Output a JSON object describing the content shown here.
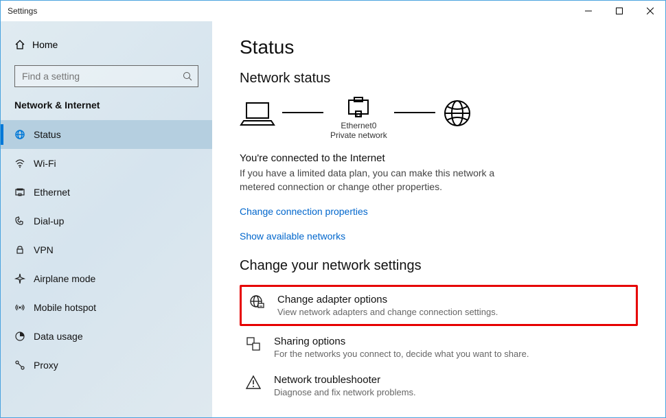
{
  "window_title": "Settings",
  "sidebar": {
    "home": "Home",
    "search_placeholder": "Find a setting",
    "category": "Network & Internet",
    "items": [
      {
        "label": "Status"
      },
      {
        "label": "Wi-Fi"
      },
      {
        "label": "Ethernet"
      },
      {
        "label": "Dial-up"
      },
      {
        "label": "VPN"
      },
      {
        "label": "Airplane mode"
      },
      {
        "label": "Mobile hotspot"
      },
      {
        "label": "Data usage"
      },
      {
        "label": "Proxy"
      }
    ]
  },
  "main": {
    "title": "Status",
    "subtitle": "Network status",
    "diagram": {
      "mid_caption1": "Ethernet0",
      "mid_caption2": "Private network"
    },
    "connected_head": "You're connected to the Internet",
    "connected_desc": "If you have a limited data plan, you can make this network a metered connection or change other properties.",
    "link1": "Change connection properties",
    "link2": "Show available networks",
    "change_section": "Change your network settings",
    "options": [
      {
        "title": "Change adapter options",
        "desc": "View network adapters and change connection settings."
      },
      {
        "title": "Sharing options",
        "desc": "For the networks you connect to, decide what you want to share."
      },
      {
        "title": "Network troubleshooter",
        "desc": "Diagnose and fix network problems."
      }
    ]
  }
}
